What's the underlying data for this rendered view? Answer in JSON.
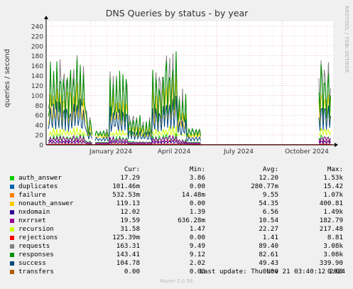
{
  "chart_data": {
    "type": "line",
    "title": "DNS Queries by status - by year",
    "ylabel": "queries / second",
    "ylim": [
      0,
      250
    ],
    "y_ticks": [
      0,
      20,
      40,
      60,
      80,
      100,
      120,
      140,
      160,
      180,
      200,
      220,
      240
    ],
    "x_ticks": [
      "January 2024",
      "April 2024",
      "July 2024",
      "October 2024"
    ],
    "grid": true,
    "legend_placement": "bottom",
    "legend_headers": [
      "Cur:",
      "Min:",
      "Avg:",
      "Max:"
    ],
    "series": [
      {
        "name": "auth_answer",
        "color": "#00cc00",
        "cur": "17.29",
        "min": "3.86",
        "avg": "12.20",
        "max": "1.53k"
      },
      {
        "name": "duplicates",
        "color": "#0066b3",
        "cur": "101.46m",
        "min": "0.00",
        "avg": "280.77m",
        "max": "15.42"
      },
      {
        "name": "failure",
        "color": "#ff8000",
        "cur": "532.53m",
        "min": "14.48m",
        "avg": "9.55",
        "max": "1.07k"
      },
      {
        "name": "nonauth_answer",
        "color": "#ffcc00",
        "cur": "119.13",
        "min": "0.00",
        "avg": "54.35",
        "max": "400.81"
      },
      {
        "name": "nxdomain",
        "color": "#330099",
        "cur": "12.02",
        "min": "1.39",
        "avg": "6.56",
        "max": "1.49k"
      },
      {
        "name": "nxrrset",
        "color": "#990099",
        "cur": "19.59",
        "min": "636.28m",
        "avg": "10.54",
        "max": "182.79"
      },
      {
        "name": "recursion",
        "color": "#ccff00",
        "cur": "31.58",
        "min": "1.47",
        "avg": "22.27",
        "max": "217.48"
      },
      {
        "name": "rejections",
        "color": "#ff0000",
        "cur": "125.39m",
        "min": "0.00",
        "avg": "1.41",
        "max": "8.81"
      },
      {
        "name": "requests",
        "color": "#808080",
        "cur": "163.31",
        "min": "9.49",
        "avg": "89.40",
        "max": "3.08k"
      },
      {
        "name": "responses",
        "color": "#008f00",
        "cur": "143.41",
        "min": "9.12",
        "avg": "82.61",
        "max": "3.08k"
      },
      {
        "name": "success",
        "color": "#00487d",
        "cur": "104.78",
        "min": "2.02",
        "avg": "49.43",
        "max": "339.90"
      },
      {
        "name": "transfers",
        "color": "#b35a00",
        "cur": "0.00",
        "min": "0.00",
        "avg": "0.00",
        "max": "0.00"
      }
    ]
  },
  "footer": {
    "last_update": "Last update: Thu Nov 21 03:40:12 2024",
    "version": "Munin 2.0.56",
    "side_label": "RRDTOOL / TOBI OETIKER"
  }
}
